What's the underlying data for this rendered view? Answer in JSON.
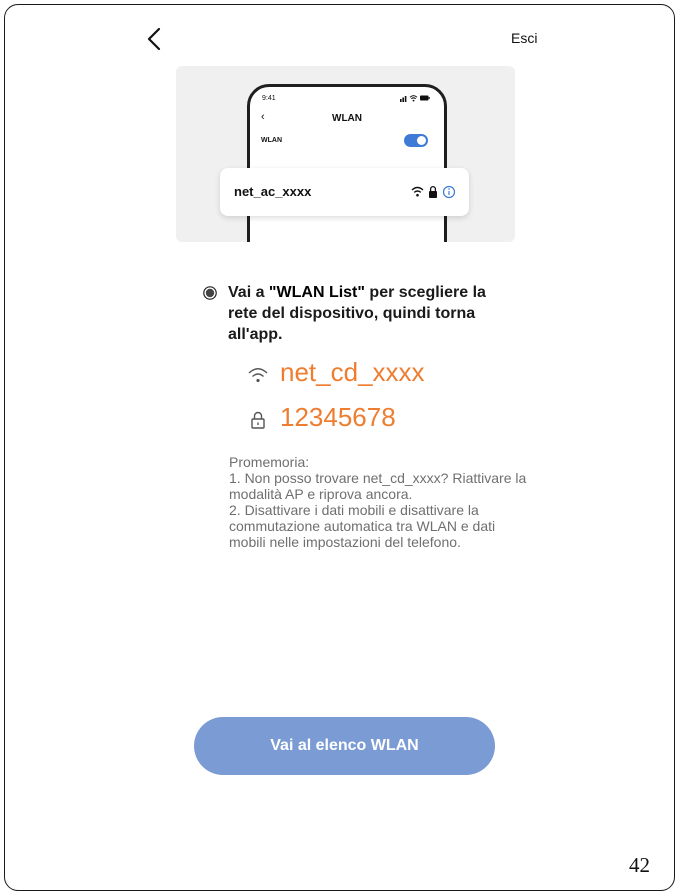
{
  "header": {
    "exit_label": "Esci"
  },
  "illustration": {
    "status_time": "9:41",
    "screen_title": "WLAN",
    "wlan_label": "WLAN",
    "network_name": "net_ac_xxxx"
  },
  "instruction": {
    "prefix": "Vai a ",
    "highlight": "\"WLAN List\"",
    "suffix": " per scegliere la rete del dispositivo, quindi torna all'app."
  },
  "network": {
    "ssid": "net_cd_xxxx",
    "password": "12345678"
  },
  "reminder": {
    "title": "Promemoria:",
    "item1": "1. Non posso trovare net_cd_xxxx? Riattivare la modalità AP e riprova ancora.",
    "item2": "2. Disattivare i dati mobili e disattivare la commutazione automatica tra WLAN e dati mobili nelle impostazioni del telefono."
  },
  "cta_label": "Vai al elenco WLAN",
  "page_number": "42",
  "colors": {
    "accent": "#ee7d2f",
    "button": "#7b9bd4",
    "toggle": "#3f7ad6",
    "info": "#3f7ad6"
  },
  "icons": [
    "back-arrow-icon",
    "wifi-icon",
    "lock-icon",
    "info-icon",
    "radio-dot-icon",
    "signal-icon",
    "battery-icon"
  ]
}
